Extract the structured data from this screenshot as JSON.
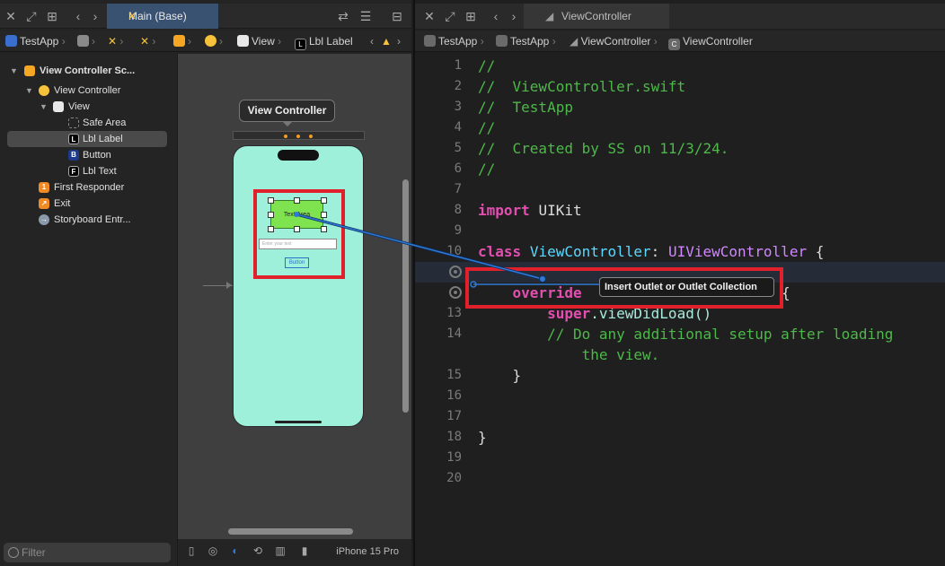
{
  "left_pane": {
    "tab_title": "Main (Base)",
    "jumpbar": {
      "project": "TestApp",
      "view": "View",
      "item": "Lbl Label"
    },
    "outline": [
      {
        "label": "View Controller Sc...",
        "icon": "scene-icon",
        "icon_color": "#f5a623"
      },
      {
        "label": "View Controller",
        "icon": "view-controller-icon",
        "icon_color": "#f5a623"
      },
      {
        "label": "View",
        "icon": "view-icon",
        "icon_color": "#e8e8e8"
      },
      {
        "label": "Safe Area",
        "icon": "safe-area-icon",
        "icon_color": "#888888"
      },
      {
        "label": "Lbl Label",
        "icon": "label-icon",
        "icon_glyph": "L",
        "icon_color": "#000000"
      },
      {
        "label": "Button",
        "icon": "button-icon",
        "icon_glyph": "B",
        "icon_color": "#1c3b8a"
      },
      {
        "label": "Lbl Text",
        "icon": "textfield-icon",
        "icon_glyph": "F",
        "icon_color": "#000000"
      },
      {
        "label": "First Responder",
        "icon": "first-responder-icon",
        "icon_glyph": "1",
        "icon_color": "#f08a24"
      },
      {
        "label": "Exit",
        "icon": "exit-icon",
        "icon_color": "#f08a24"
      },
      {
        "label": "Storyboard Entr...",
        "icon": "storyboard-entry-icon",
        "icon_color": "#8a9aa8"
      }
    ],
    "filter_placeholder": "Filter",
    "canvas": {
      "scene_title": "View Controller",
      "label_text": "Text Area",
      "textfield_placeholder": "Enter your text",
      "button_text": "Button"
    },
    "device": "iPhone 15 Pro"
  },
  "right_pane": {
    "tab_title": "ViewController",
    "jumpbar": [
      "TestApp",
      "TestApp",
      "ViewController",
      "ViewController"
    ],
    "code_lines": [
      {
        "n": "1"
      },
      {
        "n": "2"
      },
      {
        "n": "3"
      },
      {
        "n": "4"
      },
      {
        "n": "5"
      },
      {
        "n": "6"
      },
      {
        "n": "7"
      },
      {
        "n": "8"
      },
      {
        "n": "9"
      },
      {
        "n": "10"
      },
      {
        "n": ""
      },
      {
        "n": ""
      },
      {
        "n": "13"
      },
      {
        "n": "14"
      },
      {
        "n": ""
      },
      {
        "n": "15"
      },
      {
        "n": "16"
      },
      {
        "n": "17"
      },
      {
        "n": "18"
      },
      {
        "n": "19"
      },
      {
        "n": "20"
      }
    ],
    "code": {
      "l1": "//",
      "l2": "//  ViewController.swift",
      "l3": "//  TestApp",
      "l4": "//",
      "l5": "//  Created by SS on 11/3/24.",
      "l6": "//",
      "l8_kw": "import",
      "l8_mod": "UIKit",
      "l10_kw": "class",
      "l10_name": "ViewController",
      "l10_colon": ":",
      "l10_super": "UIViewController",
      "l10_brace": "{",
      "l12_kw": "override",
      "l12_brace": "{",
      "l13_kw": "super",
      "l13_fn": ".viewDidLoad()",
      "l14_c1": "// Do any additional setup after loading",
      "l14_c2": "the view.",
      "l15": "}",
      "l18": "}"
    },
    "tooltip": "Insert Outlet or Outlet Collection"
  },
  "colors": {
    "accent_tab": "#3a5272",
    "red_highlight": "#e0212b",
    "phone_bg": "#9ff0db",
    "label_bg": "#7ee34f",
    "connector": "#2f7ad3"
  }
}
